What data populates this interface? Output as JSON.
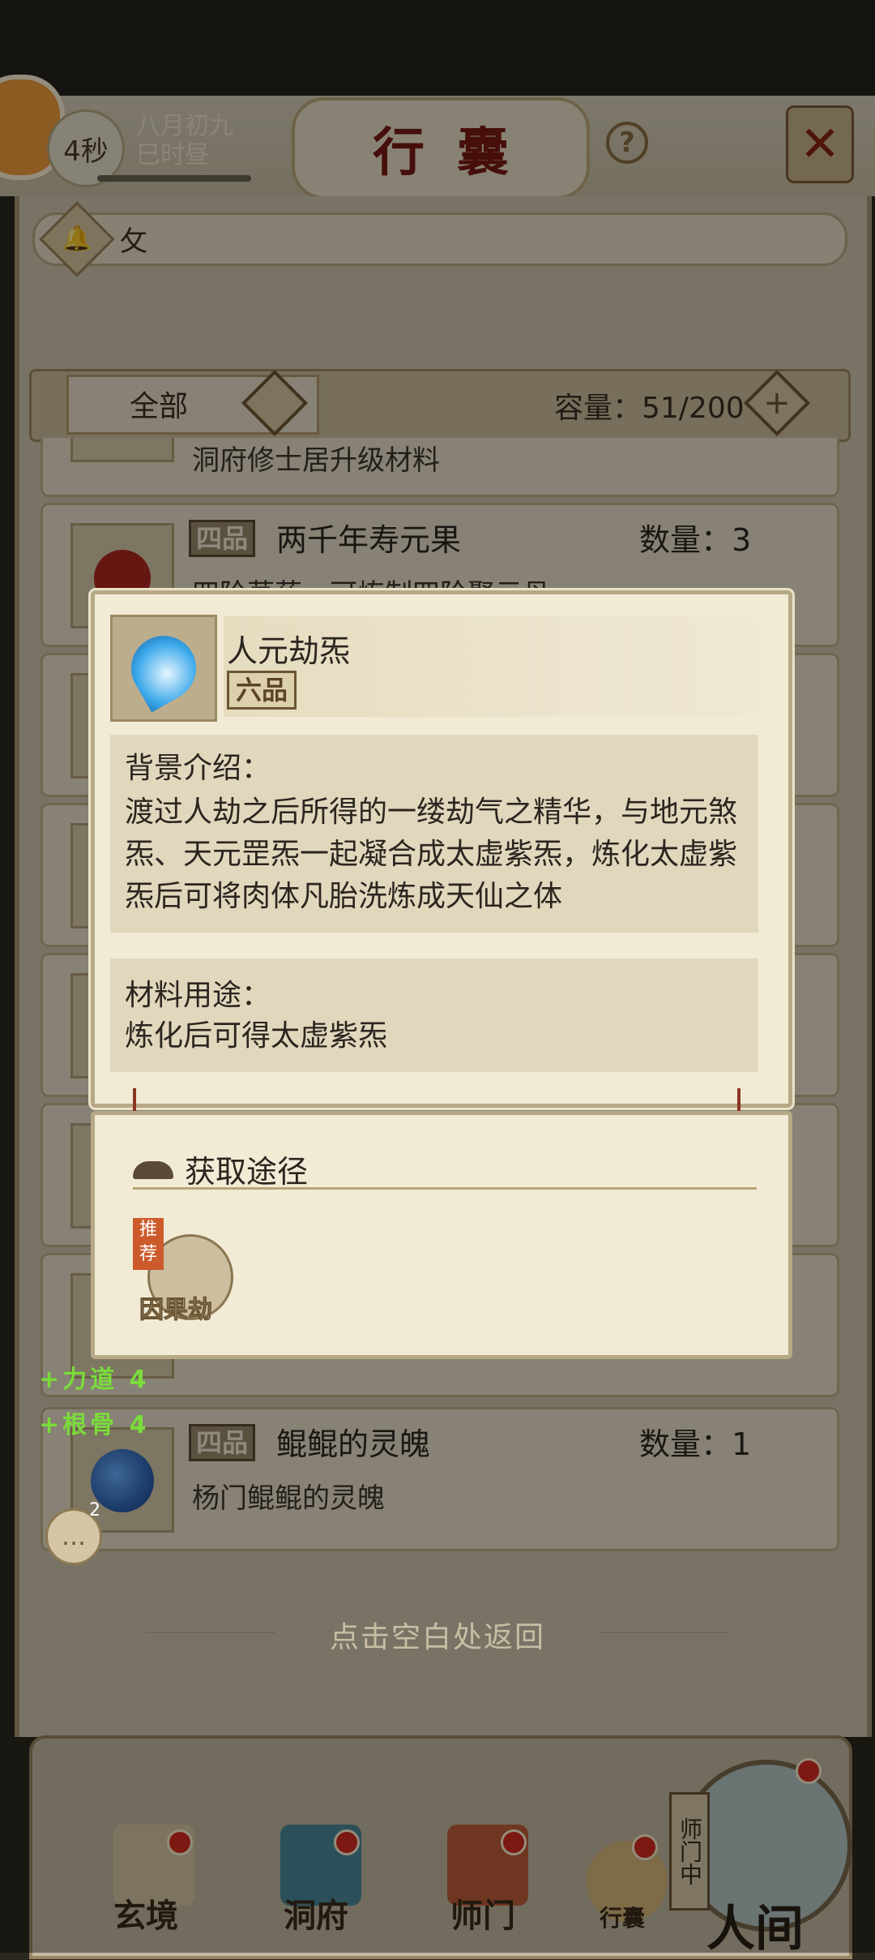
{
  "header": {
    "timer": "4秒",
    "date_line1": "八月初九",
    "date_line2": "巳时昼",
    "title": "行囊",
    "help": "?",
    "close": "✕"
  },
  "search": {
    "value": "攵"
  },
  "filter": {
    "label": "全部",
    "capacity": "容量：51/200"
  },
  "items": [
    {
      "grade": "",
      "name": "",
      "qty": "",
      "desc": "洞府修士居升级材料"
    },
    {
      "grade": "四品",
      "name": "两千年寿元果",
      "qty": "数量：3",
      "desc": "四阶草药，可炼制四阶聚元丹"
    },
    {
      "grade": "四品",
      "name": "鲲鲲的灵魄",
      "qty": "数量：1",
      "desc": "杨门鲲鲲的灵魄"
    }
  ],
  "stats": {
    "line1": "+力道 4",
    "line2": "+根骨 4"
  },
  "chat": {
    "badge": "2"
  },
  "popup": {
    "name": "人元劫炁",
    "grade": "六品",
    "bg_title": "背景介绍：",
    "bg_text": "渡过人劫之后所得的一缕劫气之精华，与地元煞炁、天元罡炁一起凝合成太虚紫炁，炼化太虚紫炁后可将肉体凡胎洗炼成天仙之体",
    "use_title": "材料用途：",
    "use_text": "炼化后可得太虚紫炁"
  },
  "source": {
    "title": "获取途径",
    "tag": "推荐",
    "item_label": "因果劫"
  },
  "back_hint": "点击空白处返回",
  "nav": [
    {
      "label": "玄境"
    },
    {
      "label": "洞府"
    },
    {
      "label": "师门"
    },
    {
      "label": "行囊"
    }
  ],
  "human": {
    "label": "人间",
    "tag": "师门中"
  },
  "colors": {
    "accent": "#7a1a12",
    "stat_green": "#7adc3a",
    "badge_red": "#d42b1f"
  }
}
